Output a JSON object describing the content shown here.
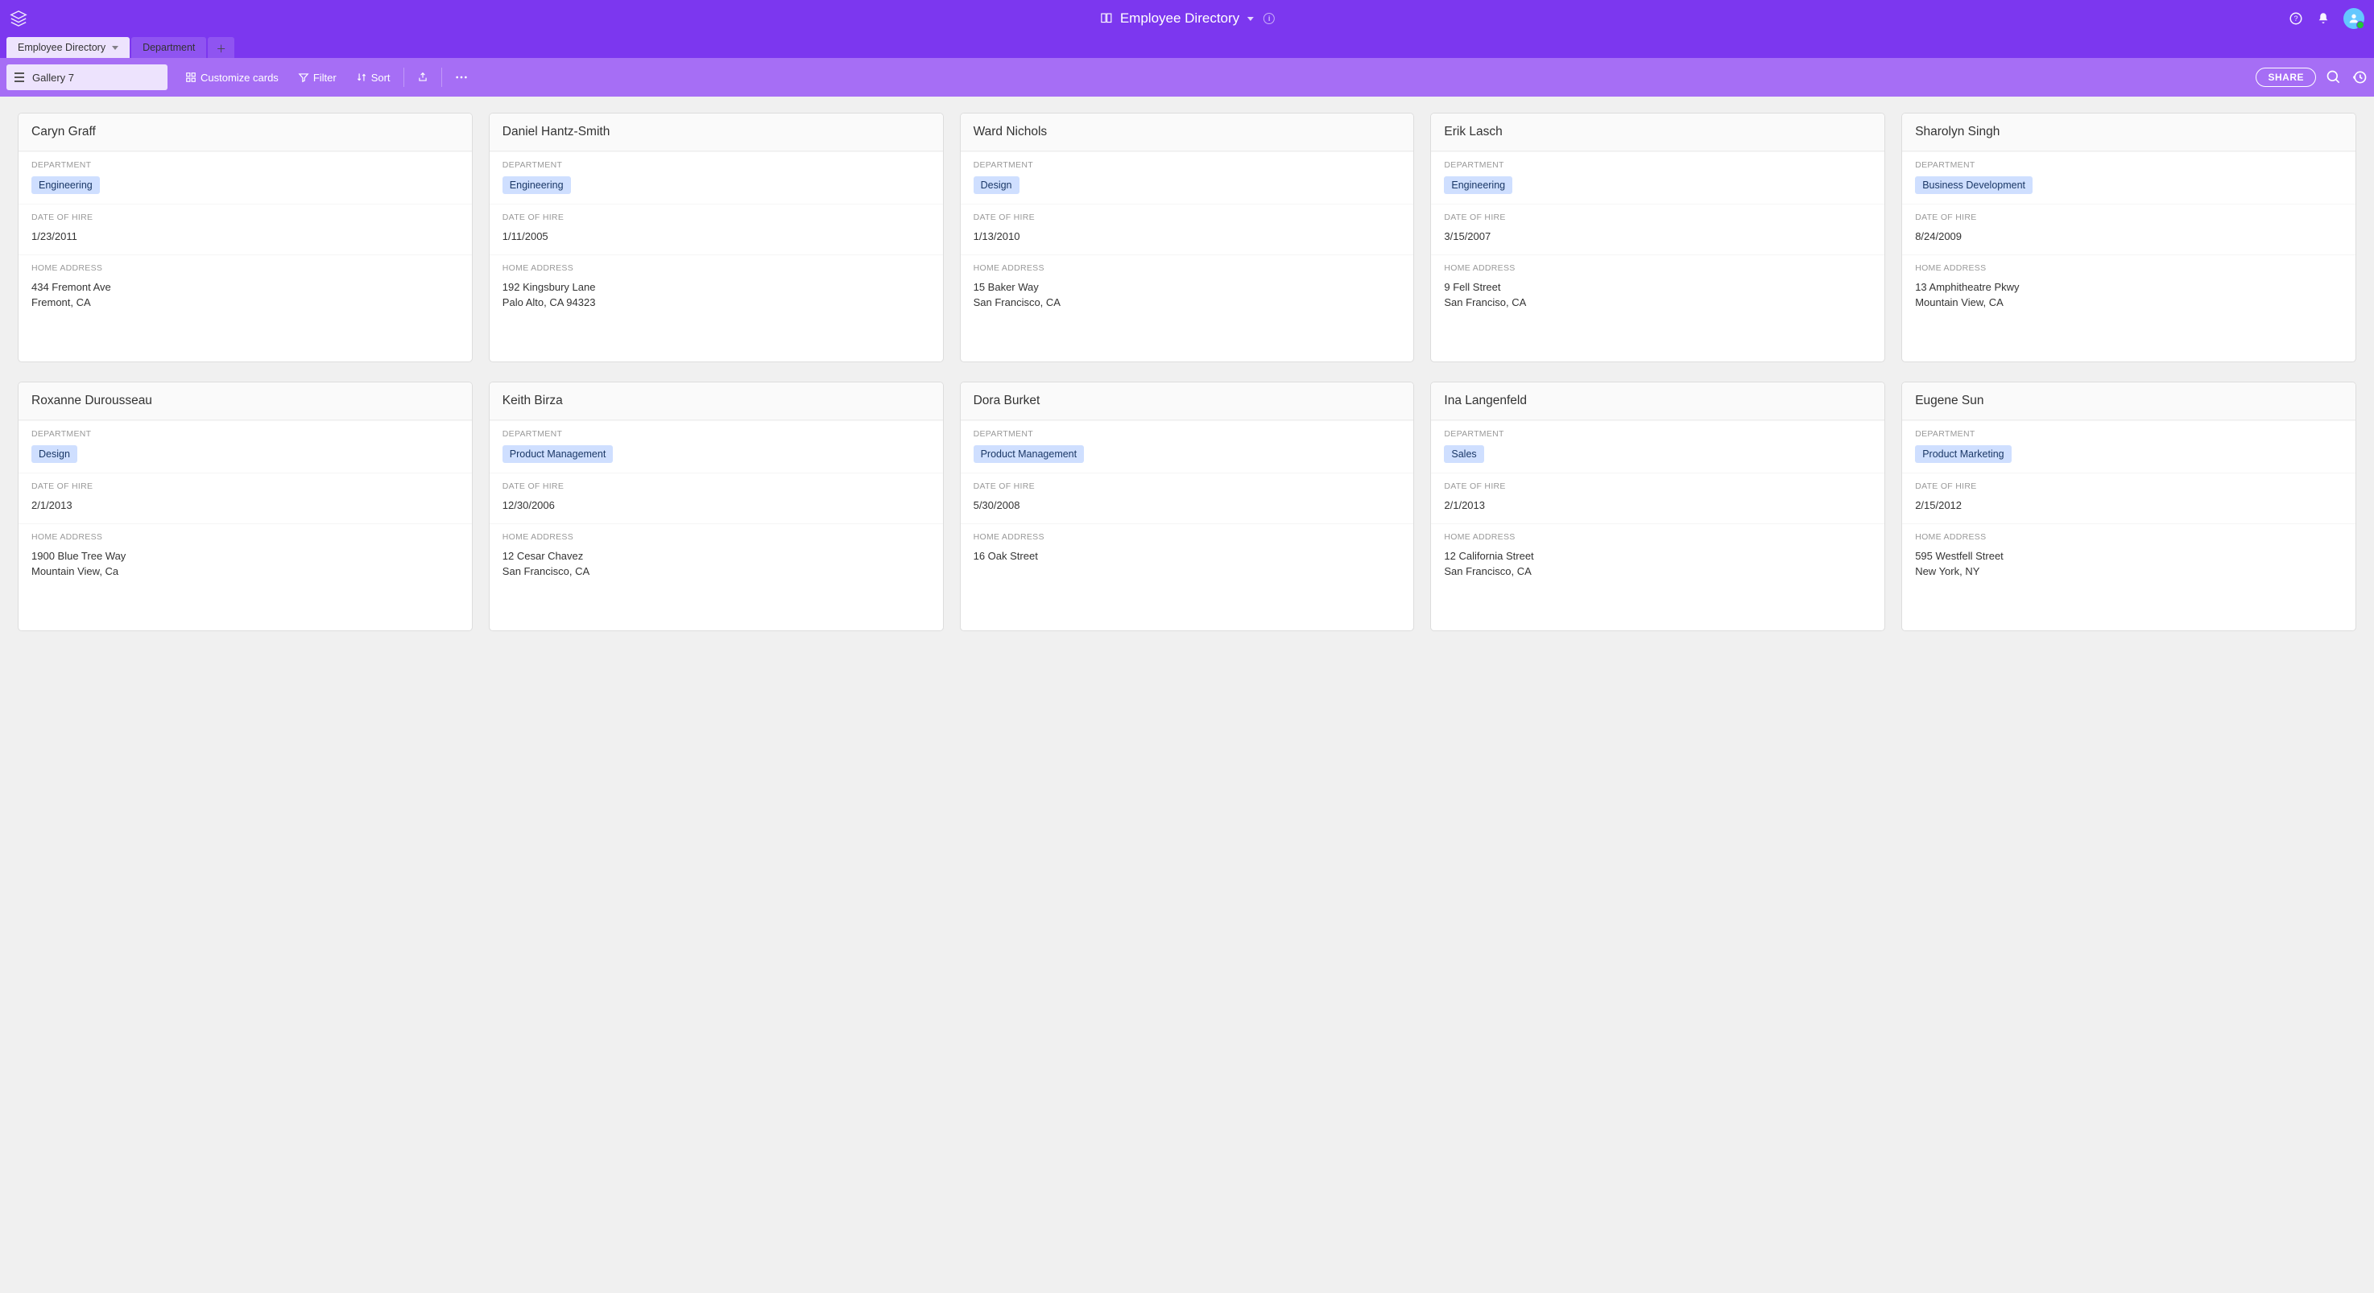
{
  "header": {
    "title": "Employee Directory"
  },
  "tabs": [
    {
      "label": "Employee Directory",
      "active": true
    },
    {
      "label": "Department",
      "active": false
    }
  ],
  "toolbar": {
    "view_name": "Gallery 7",
    "customize": "Customize cards",
    "filter": "Filter",
    "sort": "Sort",
    "share": "SHARE"
  },
  "fields": {
    "department": "DEPARTMENT",
    "date_of_hire": "DATE OF HIRE",
    "home_address": "HOME ADDRESS"
  },
  "employees": [
    {
      "name": "Caryn Graff",
      "department": "Engineering",
      "date_of_hire": "1/23/2011",
      "home_address": "434 Fremont Ave\nFremont, CA"
    },
    {
      "name": "Daniel Hantz-Smith",
      "department": "Engineering",
      "date_of_hire": "1/11/2005",
      "home_address": "192 Kingsbury Lane\nPalo Alto, CA 94323"
    },
    {
      "name": "Ward Nichols",
      "department": "Design",
      "date_of_hire": "1/13/2010",
      "home_address": "15 Baker Way\nSan Francisco, CA"
    },
    {
      "name": "Erik Lasch",
      "department": "Engineering",
      "date_of_hire": "3/15/2007",
      "home_address": "9 Fell Street\nSan Franciso, CA"
    },
    {
      "name": "Sharolyn Singh",
      "department": "Business Development",
      "date_of_hire": "8/24/2009",
      "home_address": "13 Amphitheatre Pkwy\nMountain View, CA"
    },
    {
      "name": "Roxanne Durousseau",
      "department": "Design",
      "date_of_hire": "2/1/2013",
      "home_address": "1900 Blue Tree Way\nMountain View, Ca"
    },
    {
      "name": "Keith Birza",
      "department": "Product Management",
      "date_of_hire": "12/30/2006",
      "home_address": "12 Cesar Chavez\nSan Francisco, CA"
    },
    {
      "name": "Dora Burket",
      "department": "Product Management",
      "date_of_hire": "5/30/2008",
      "home_address": "16 Oak Street"
    },
    {
      "name": "Ina Langenfeld",
      "department": "Sales",
      "date_of_hire": "2/1/2013",
      "home_address": "12 California Street\nSan Francisco, CA"
    },
    {
      "name": "Eugene Sun",
      "department": "Product Marketing",
      "date_of_hire": "2/15/2012",
      "home_address": "595 Westfell Street\nNew York, NY"
    }
  ]
}
